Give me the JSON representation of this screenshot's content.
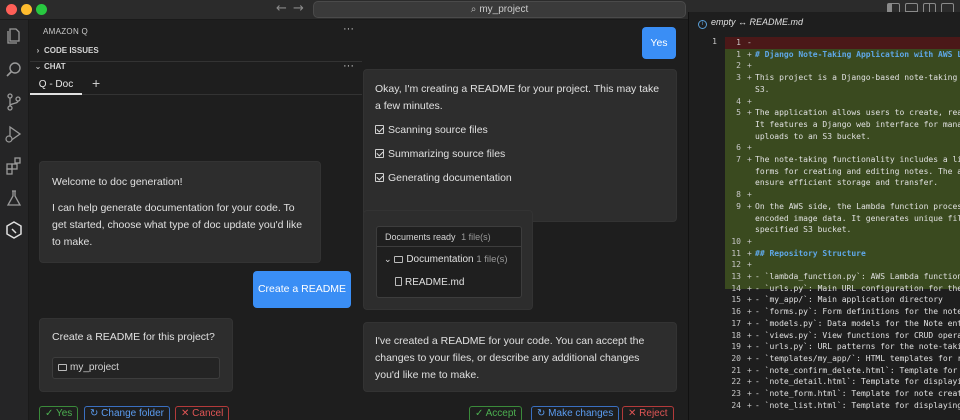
{
  "titlebar": {
    "search_text": "my_project",
    "back_arrow": "←",
    "forward_arrow": "→"
  },
  "sidepanel": {
    "header": "AMAZON Q",
    "header_more": "···",
    "code_issues": "CODE ISSUES",
    "chat": "CHAT",
    "chat_more": "···",
    "tab_label": "Q - Doc",
    "add_tab": "+"
  },
  "conversation_left": {
    "welcome_title": "Welcome to doc generation!",
    "welcome_body": "I can help generate documentation for your code. To get started, choose what type of doc update you'd like to make.",
    "create_readme_button": "Create a README",
    "confirm_question": "Create a README for this project?",
    "folder_name": "my_project",
    "yes_button": "Yes",
    "change_folder_button": "Change folder",
    "cancel_button": "Cancel"
  },
  "conversation_right": {
    "yes_reply": "Yes",
    "progress_intro": "Okay, I'm creating a README for your project. This may take a few minutes.",
    "steps": [
      "Scanning source files",
      "Summarizing source files",
      "Generating documentation"
    ],
    "docs_ready_label": "Documents ready",
    "docs_ready_count": "1 file(s)",
    "docs_folder": "Documentation",
    "docs_folder_count": "1 file(s)",
    "docs_file": "README.md",
    "created_message": "I've created a README for your code. You can accept the changes to your files, or describe any additional changes you'd like me to make.",
    "accept_button": "Accept",
    "make_changes_button": "Make changes",
    "reject_button": "Reject"
  },
  "editor": {
    "tab_title": "empty ↔ README.md",
    "left_line": "1",
    "lines": [
      {
        "num": "1",
        "sign": "-",
        "text": "",
        "kind": "removed"
      },
      {
        "num": "1",
        "sign": "+",
        "text": "# Django Note-Taking Application with AWS Lambda",
        "kind": "heading"
      },
      {
        "num": "2",
        "sign": "+",
        "text": "",
        "kind": "plain"
      },
      {
        "num": "3",
        "sign": "+",
        "text": "This project is a Django-based note-taking application",
        "kind": "plain"
      },
      {
        "num": "",
        "sign": "",
        "text": "S3.",
        "kind": "plain"
      },
      {
        "num": "4",
        "sign": "+",
        "text": "",
        "kind": "plain"
      },
      {
        "num": "5",
        "sign": "+",
        "text": "The application allows users to create, read, update",
        "kind": "plain"
      },
      {
        "num": "",
        "sign": "",
        "text": "It features a Django web interface for managing notes",
        "kind": "plain"
      },
      {
        "num": "",
        "sign": "",
        "text": "uploads to an S3 bucket.",
        "kind": "plain"
      },
      {
        "num": "6",
        "sign": "+",
        "text": "",
        "kind": "plain"
      },
      {
        "num": "7",
        "sign": "+",
        "text": "The note-taking functionality includes a list view",
        "kind": "plain"
      },
      {
        "num": "",
        "sign": "",
        "text": "forms for creating and editing notes. The application",
        "kind": "plain"
      },
      {
        "num": "",
        "sign": "",
        "text": "ensure efficient storage and transfer.",
        "kind": "plain"
      },
      {
        "num": "8",
        "sign": "+",
        "text": "",
        "kind": "plain"
      },
      {
        "num": "9",
        "sign": "+",
        "text": "On the AWS side, the Lambda function processes",
        "kind": "plain"
      },
      {
        "num": "",
        "sign": "",
        "text": "encoded image data. It generates unique filenames",
        "kind": "plain"
      },
      {
        "num": "",
        "sign": "",
        "text": "specified S3 bucket.",
        "kind": "plain"
      },
      {
        "num": "10",
        "sign": "+",
        "text": "",
        "kind": "plain"
      },
      {
        "num": "11",
        "sign": "+",
        "text": "## Repository Structure",
        "kind": "heading"
      },
      {
        "num": "12",
        "sign": "+",
        "text": "",
        "kind": "plain"
      },
      {
        "num": "13",
        "sign": "+",
        "text": "- `lambda_function.py`: AWS Lambda function for",
        "kind": "code"
      },
      {
        "num": "14",
        "sign": "+",
        "text": "- `urls.py`: Main URL configuration for the Django",
        "kind": "code"
      },
      {
        "num": "15",
        "sign": "+",
        "text": "- `my_app/`: Main application directory",
        "kind": "code"
      },
      {
        "num": "16",
        "sign": "+",
        "text": "  - `forms.py`: Form definitions for the note-taking",
        "kind": "code"
      },
      {
        "num": "17",
        "sign": "+",
        "text": "  - `models.py`: Data models for the Note entity",
        "kind": "code"
      },
      {
        "num": "18",
        "sign": "+",
        "text": "  - `views.py`: View functions for CRUD operations",
        "kind": "code"
      },
      {
        "num": "19",
        "sign": "+",
        "text": "  - `urls.py`: URL patterns for the note-taking",
        "kind": "code"
      },
      {
        "num": "20",
        "sign": "+",
        "text": "  - `templates/my_app/`: HTML templates for rendering",
        "kind": "code"
      },
      {
        "num": "21",
        "sign": "+",
        "text": "    - `note_confirm_delete.html`: Template for",
        "kind": "code"
      },
      {
        "num": "22",
        "sign": "+",
        "text": "    - `note_detail.html`: Template for displaying",
        "kind": "code"
      },
      {
        "num": "23",
        "sign": "+",
        "text": "    - `note_form.html`: Template for note creation",
        "kind": "code"
      },
      {
        "num": "24",
        "sign": "+",
        "text": "    - `note_list.html`: Template for displaying",
        "kind": "code"
      }
    ]
  },
  "colors": {
    "accent_blue": "#3a8ef5",
    "diff_added": "#3a4a1f",
    "diff_removed": "#4b1818"
  }
}
